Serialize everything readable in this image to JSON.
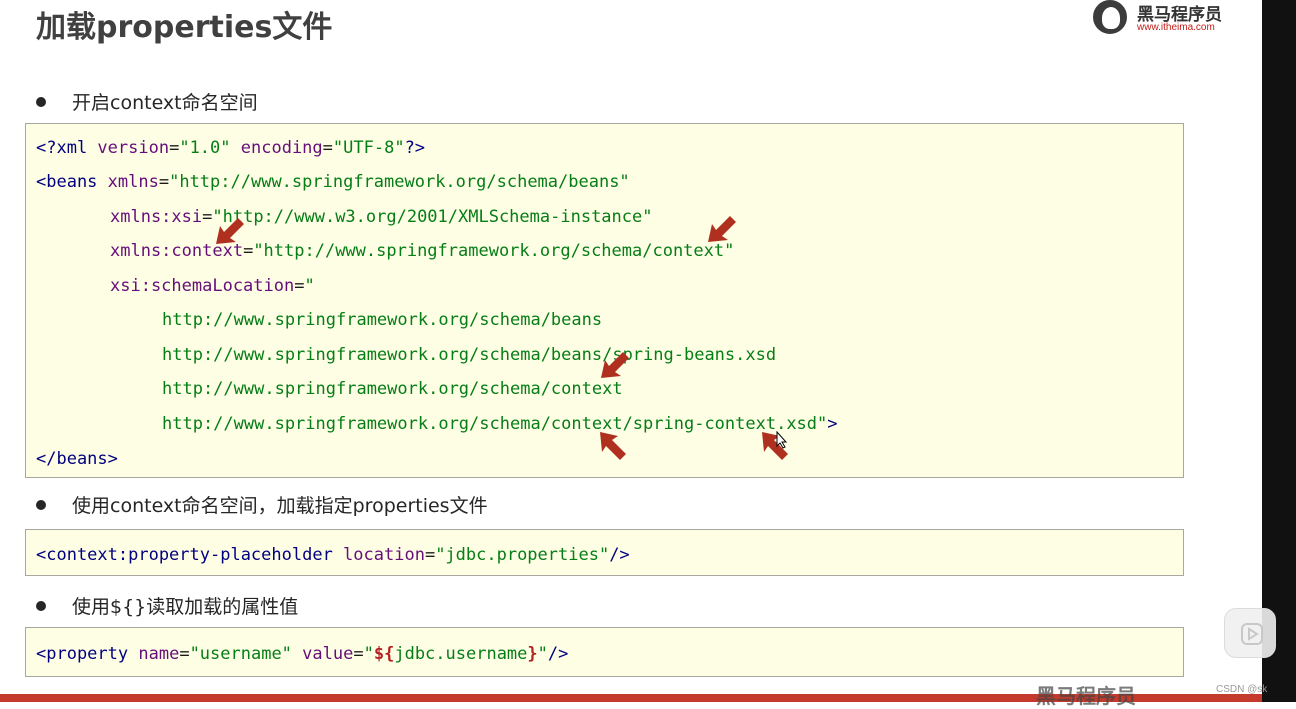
{
  "slide": {
    "title": "加载properties文件",
    "logo": {
      "name": "黑马程序员",
      "url": "www.itheima.com"
    },
    "bullets": [
      "开启context命名空间",
      "使用context命名空间，加载指定properties文件",
      "使用${}读取加载的属性值"
    ],
    "code1": {
      "l1": {
        "a": "<?xml ",
        "b": "version",
        "c": "=",
        "d": "\"1.0\"",
        "e": " ",
        "f": "encoding",
        "g": "=",
        "h": "\"UTF-8\"",
        "i": "?>"
      },
      "l2": {
        "a": "<beans ",
        "b": "xmlns",
        "c": "=",
        "d": "\"http://www.springframework.org/schema/beans\""
      },
      "l3": {
        "b": "xmlns:xsi",
        "c": "=",
        "d": "\"http://www.w3.org/2001/XMLSchema-instance\""
      },
      "l4": {
        "b": "xmlns:context",
        "c": "=",
        "d": "\"http://www.springframework.org/schema/context\""
      },
      "l5": {
        "b": "xsi:schemaLocation",
        "c": "=",
        "d": "\""
      },
      "l6": "http://www.springframework.org/schema/beans",
      "l7": "http://www.springframework.org/schema/beans/spring-beans.xsd",
      "l8": "http://www.springframework.org/schema/context",
      "l9": {
        "a": "http://www.springframework.org/schema/context/spring-context.xsd\"",
        "b": ">"
      },
      "l10": "</beans>"
    },
    "code2": {
      "a": "<context:property-placeholder ",
      "b": "location",
      "c": "=",
      "d": "\"jdbc.properties\"",
      "e": "/>"
    },
    "code3": {
      "a": "<property ",
      "b": "name",
      "c": "=",
      "d": "\"username\"",
      "e": " ",
      "f": "value",
      "g": "=",
      "h": "\"",
      "i": "${",
      "j": "jdbc.username",
      "k": "}",
      "l": "\"",
      "m": "/>"
    }
  },
  "overlay": {
    "csdn_watermark": "CSDN @sk",
    "video_brand": "黑马程序员"
  },
  "colors": {
    "tag": "#000080",
    "attr": "#660e7a",
    "value": "#067d17",
    "arrow": "#b03020",
    "code_bg": "#fefee4",
    "bottom_bar": "#c43a2c"
  }
}
